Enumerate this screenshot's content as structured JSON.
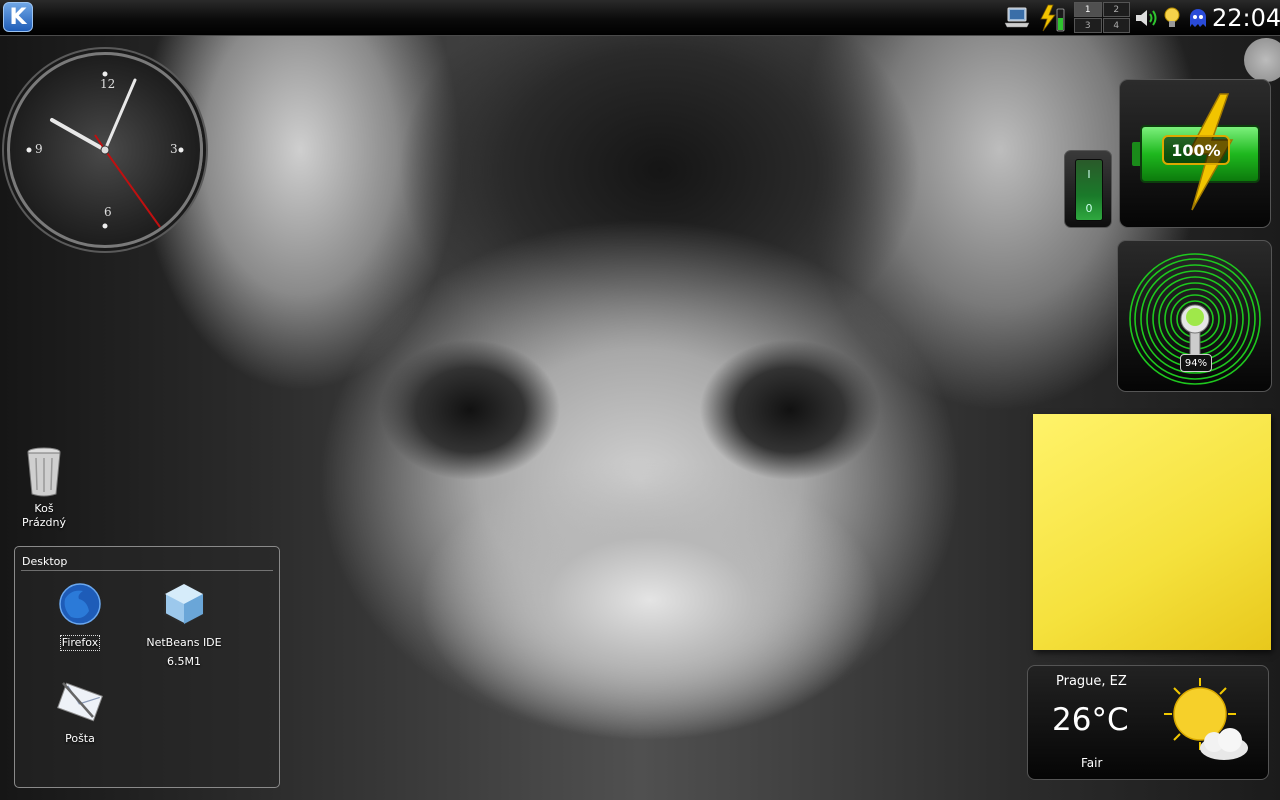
{
  "panel": {
    "launcher_glyph": "K",
    "pager_desktops": [
      "1",
      "2",
      "3",
      "4"
    ],
    "clock": "22:04",
    "tray_icons": [
      "laptop-icon",
      "power-icon",
      "speaker-icon",
      "lightbulb-icon",
      "pacman-icon"
    ]
  },
  "battery_widget": {
    "percent_label": "100%",
    "level": 1.0
  },
  "switch_widget": {
    "on_label": "I",
    "off_label": "0"
  },
  "volume_widget": {
    "percent_label": "94%",
    "level": 0.94
  },
  "weather": {
    "location": "Prague, EZ",
    "temperature": "26°C",
    "condition": "Fair"
  },
  "trash": {
    "name": "Koš",
    "status": "Prázdný"
  },
  "folder_view": {
    "title": "Desktop",
    "items": [
      {
        "label": "Firefox",
        "icon": "firefox-icon"
      },
      {
        "label": "NetBeans IDE",
        "label2": "6.5M1",
        "icon": "netbeans-icon"
      },
      {
        "label": "Pošta",
        "icon": "mail-icon"
      }
    ]
  },
  "colors": {
    "accent_green": "#1eb81e",
    "note_yellow": "#f5e13c",
    "battery_bolt": "#f2c400"
  }
}
